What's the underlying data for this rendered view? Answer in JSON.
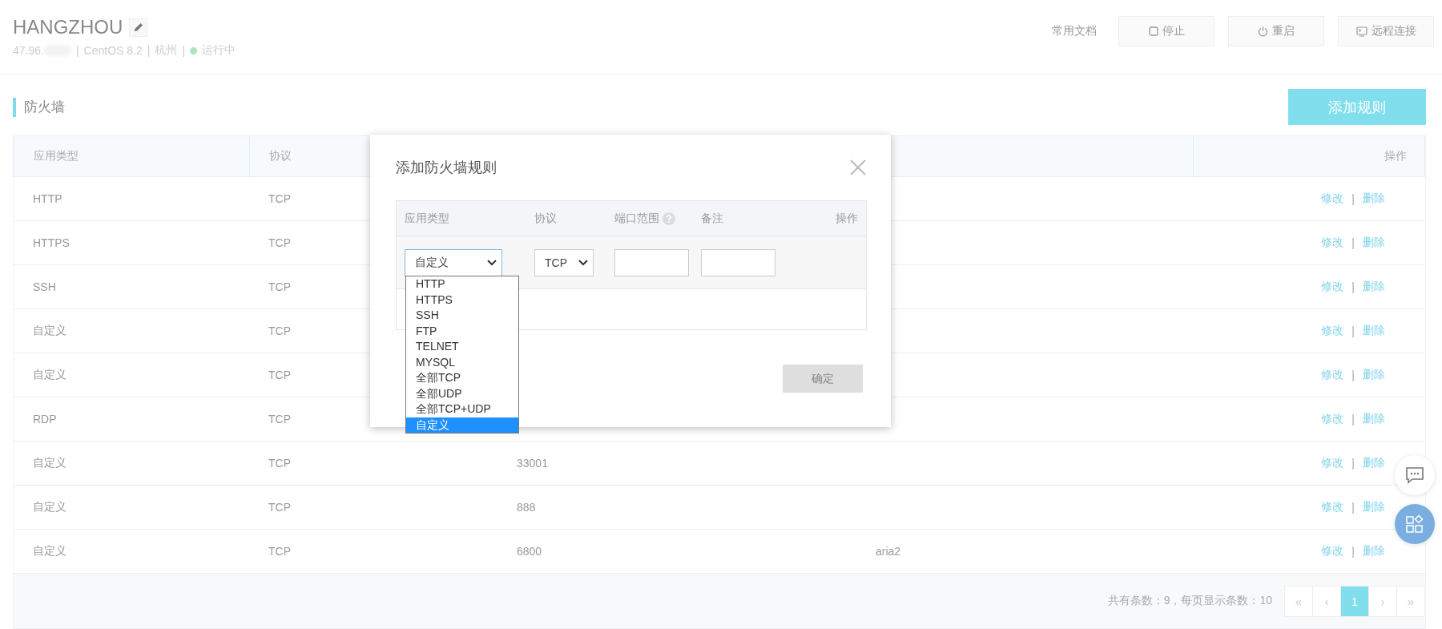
{
  "header": {
    "title": "HANGZHOU",
    "ip": "47.96.",
    "separator": "|",
    "os": "CentOS 8.2",
    "region": "杭州",
    "status": "运行中",
    "docs_link": "常用文档",
    "buttons": [
      {
        "kind": "stop",
        "label": "停止"
      },
      {
        "kind": "restart",
        "label": "重启"
      },
      {
        "kind": "remote",
        "label": "远程连接"
      }
    ]
  },
  "section": {
    "title": "防火墙",
    "add_button": "添加规则"
  },
  "table": {
    "columns": [
      "应用类型",
      "协议"
    ],
    "action_column": "操作",
    "rows": [
      {
        "app_type": "HTTP",
        "protocol": "TCP",
        "actions": [
          "修改",
          "删除"
        ]
      },
      {
        "app_type": "HTTPS",
        "protocol": "TCP",
        "actions": [
          "修改",
          "删除"
        ]
      },
      {
        "app_type": "SSH",
        "protocol": "TCP",
        "actions": [
          "修改",
          "删除"
        ]
      },
      {
        "app_type": "自定义",
        "protocol": "TCP",
        "actions": [
          "修改",
          "删除"
        ]
      },
      {
        "app_type": "自定义",
        "protocol": "TCP",
        "actions": [
          "修改",
          "删除"
        ]
      },
      {
        "app_type": "RDP",
        "protocol": "TCP",
        "actions": [
          "修改",
          "删除"
        ]
      },
      {
        "app_type": "自定义",
        "protocol": "TCP",
        "port": "33001",
        "actions": [
          "修改",
          "删除"
        ]
      },
      {
        "app_type": "自定义",
        "protocol": "TCP",
        "port": "888",
        "actions": [
          "修改",
          "删除"
        ]
      },
      {
        "app_type": "自定义",
        "protocol": "TCP",
        "port": "6800",
        "note": "aria2",
        "actions": [
          "修改",
          "删除"
        ]
      }
    ],
    "action_separator": "|"
  },
  "pagination": {
    "summary": "共有条数：9，每页显示条数：10",
    "first": "«",
    "prev": "‹",
    "pages": [
      {
        "label": "1",
        "selected": true
      }
    ],
    "next": "›",
    "last": "»"
  },
  "dialog": {
    "title": "添加防火墙规则",
    "columns": [
      {
        "label": "应用类型",
        "help": false
      },
      {
        "label": "协议",
        "help": false
      },
      {
        "label": "端口范围",
        "help": true
      },
      {
        "label": "备注",
        "help": false
      },
      {
        "label": "操作",
        "help": false
      }
    ],
    "app_select": {
      "value": "自定义",
      "expanded": true
    },
    "protocol_select": {
      "value": "TCP",
      "expanded": false
    },
    "options": [
      {
        "label": "HTTP",
        "selected": false
      },
      {
        "label": "HTTPS",
        "selected": false
      },
      {
        "label": "SSH",
        "selected": false
      },
      {
        "label": "FTP",
        "selected": false
      },
      {
        "label": "TELNET",
        "selected": false
      },
      {
        "label": "MYSQL",
        "selected": false
      },
      {
        "label": "全部TCP",
        "selected": false
      },
      {
        "label": "全部UDP",
        "selected": false
      },
      {
        "label": "全部TCP+UDP",
        "selected": false
      },
      {
        "label": "自定义",
        "selected": true
      }
    ],
    "confirm": {
      "label": "确定",
      "disabled": true
    }
  }
}
